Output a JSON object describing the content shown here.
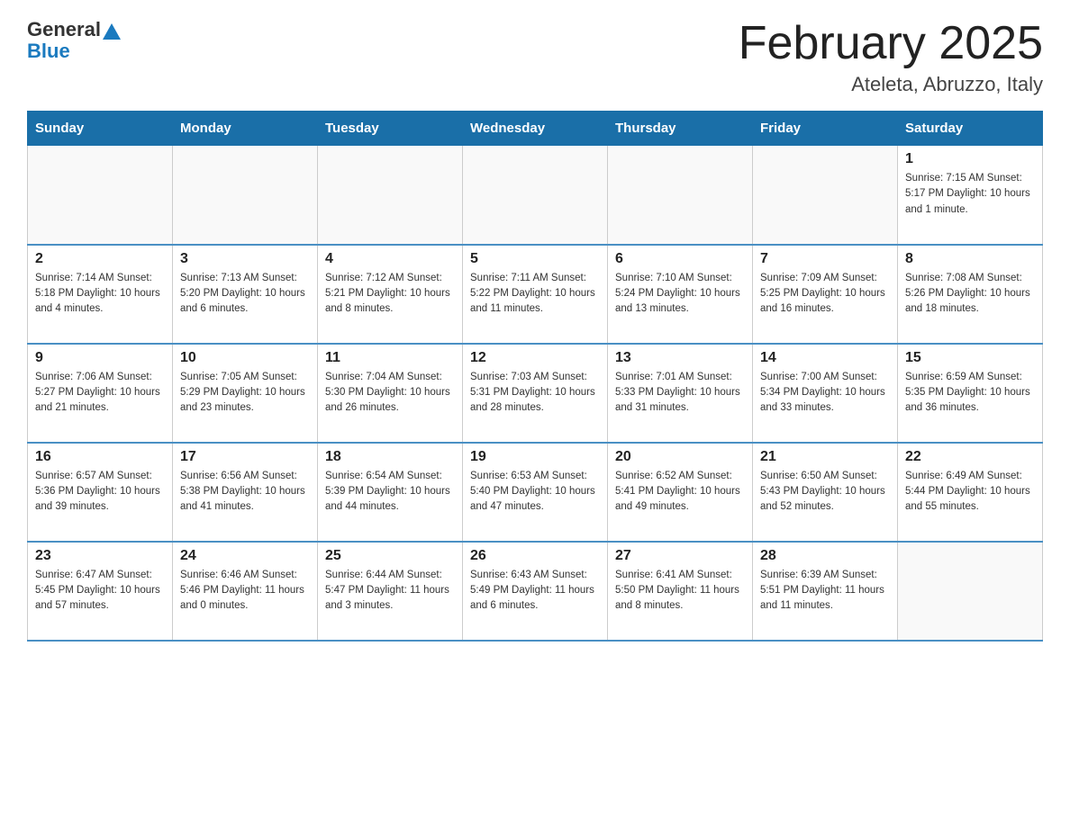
{
  "header": {
    "logo_general": "General",
    "logo_blue": "Blue",
    "title": "February 2025",
    "location": "Ateleta, Abruzzo, Italy"
  },
  "weekdays": [
    "Sunday",
    "Monday",
    "Tuesday",
    "Wednesday",
    "Thursday",
    "Friday",
    "Saturday"
  ],
  "weeks": [
    [
      {
        "day": "",
        "info": ""
      },
      {
        "day": "",
        "info": ""
      },
      {
        "day": "",
        "info": ""
      },
      {
        "day": "",
        "info": ""
      },
      {
        "day": "",
        "info": ""
      },
      {
        "day": "",
        "info": ""
      },
      {
        "day": "1",
        "info": "Sunrise: 7:15 AM\nSunset: 5:17 PM\nDaylight: 10 hours and 1 minute."
      }
    ],
    [
      {
        "day": "2",
        "info": "Sunrise: 7:14 AM\nSunset: 5:18 PM\nDaylight: 10 hours and 4 minutes."
      },
      {
        "day": "3",
        "info": "Sunrise: 7:13 AM\nSunset: 5:20 PM\nDaylight: 10 hours and 6 minutes."
      },
      {
        "day": "4",
        "info": "Sunrise: 7:12 AM\nSunset: 5:21 PM\nDaylight: 10 hours and 8 minutes."
      },
      {
        "day": "5",
        "info": "Sunrise: 7:11 AM\nSunset: 5:22 PM\nDaylight: 10 hours and 11 minutes."
      },
      {
        "day": "6",
        "info": "Sunrise: 7:10 AM\nSunset: 5:24 PM\nDaylight: 10 hours and 13 minutes."
      },
      {
        "day": "7",
        "info": "Sunrise: 7:09 AM\nSunset: 5:25 PM\nDaylight: 10 hours and 16 minutes."
      },
      {
        "day": "8",
        "info": "Sunrise: 7:08 AM\nSunset: 5:26 PM\nDaylight: 10 hours and 18 minutes."
      }
    ],
    [
      {
        "day": "9",
        "info": "Sunrise: 7:06 AM\nSunset: 5:27 PM\nDaylight: 10 hours and 21 minutes."
      },
      {
        "day": "10",
        "info": "Sunrise: 7:05 AM\nSunset: 5:29 PM\nDaylight: 10 hours and 23 minutes."
      },
      {
        "day": "11",
        "info": "Sunrise: 7:04 AM\nSunset: 5:30 PM\nDaylight: 10 hours and 26 minutes."
      },
      {
        "day": "12",
        "info": "Sunrise: 7:03 AM\nSunset: 5:31 PM\nDaylight: 10 hours and 28 minutes."
      },
      {
        "day": "13",
        "info": "Sunrise: 7:01 AM\nSunset: 5:33 PM\nDaylight: 10 hours and 31 minutes."
      },
      {
        "day": "14",
        "info": "Sunrise: 7:00 AM\nSunset: 5:34 PM\nDaylight: 10 hours and 33 minutes."
      },
      {
        "day": "15",
        "info": "Sunrise: 6:59 AM\nSunset: 5:35 PM\nDaylight: 10 hours and 36 minutes."
      }
    ],
    [
      {
        "day": "16",
        "info": "Sunrise: 6:57 AM\nSunset: 5:36 PM\nDaylight: 10 hours and 39 minutes."
      },
      {
        "day": "17",
        "info": "Sunrise: 6:56 AM\nSunset: 5:38 PM\nDaylight: 10 hours and 41 minutes."
      },
      {
        "day": "18",
        "info": "Sunrise: 6:54 AM\nSunset: 5:39 PM\nDaylight: 10 hours and 44 minutes."
      },
      {
        "day": "19",
        "info": "Sunrise: 6:53 AM\nSunset: 5:40 PM\nDaylight: 10 hours and 47 minutes."
      },
      {
        "day": "20",
        "info": "Sunrise: 6:52 AM\nSunset: 5:41 PM\nDaylight: 10 hours and 49 minutes."
      },
      {
        "day": "21",
        "info": "Sunrise: 6:50 AM\nSunset: 5:43 PM\nDaylight: 10 hours and 52 minutes."
      },
      {
        "day": "22",
        "info": "Sunrise: 6:49 AM\nSunset: 5:44 PM\nDaylight: 10 hours and 55 minutes."
      }
    ],
    [
      {
        "day": "23",
        "info": "Sunrise: 6:47 AM\nSunset: 5:45 PM\nDaylight: 10 hours and 57 minutes."
      },
      {
        "day": "24",
        "info": "Sunrise: 6:46 AM\nSunset: 5:46 PM\nDaylight: 11 hours and 0 minutes."
      },
      {
        "day": "25",
        "info": "Sunrise: 6:44 AM\nSunset: 5:47 PM\nDaylight: 11 hours and 3 minutes."
      },
      {
        "day": "26",
        "info": "Sunrise: 6:43 AM\nSunset: 5:49 PM\nDaylight: 11 hours and 6 minutes."
      },
      {
        "day": "27",
        "info": "Sunrise: 6:41 AM\nSunset: 5:50 PM\nDaylight: 11 hours and 8 minutes."
      },
      {
        "day": "28",
        "info": "Sunrise: 6:39 AM\nSunset: 5:51 PM\nDaylight: 11 hours and 11 minutes."
      },
      {
        "day": "",
        "info": ""
      }
    ]
  ]
}
